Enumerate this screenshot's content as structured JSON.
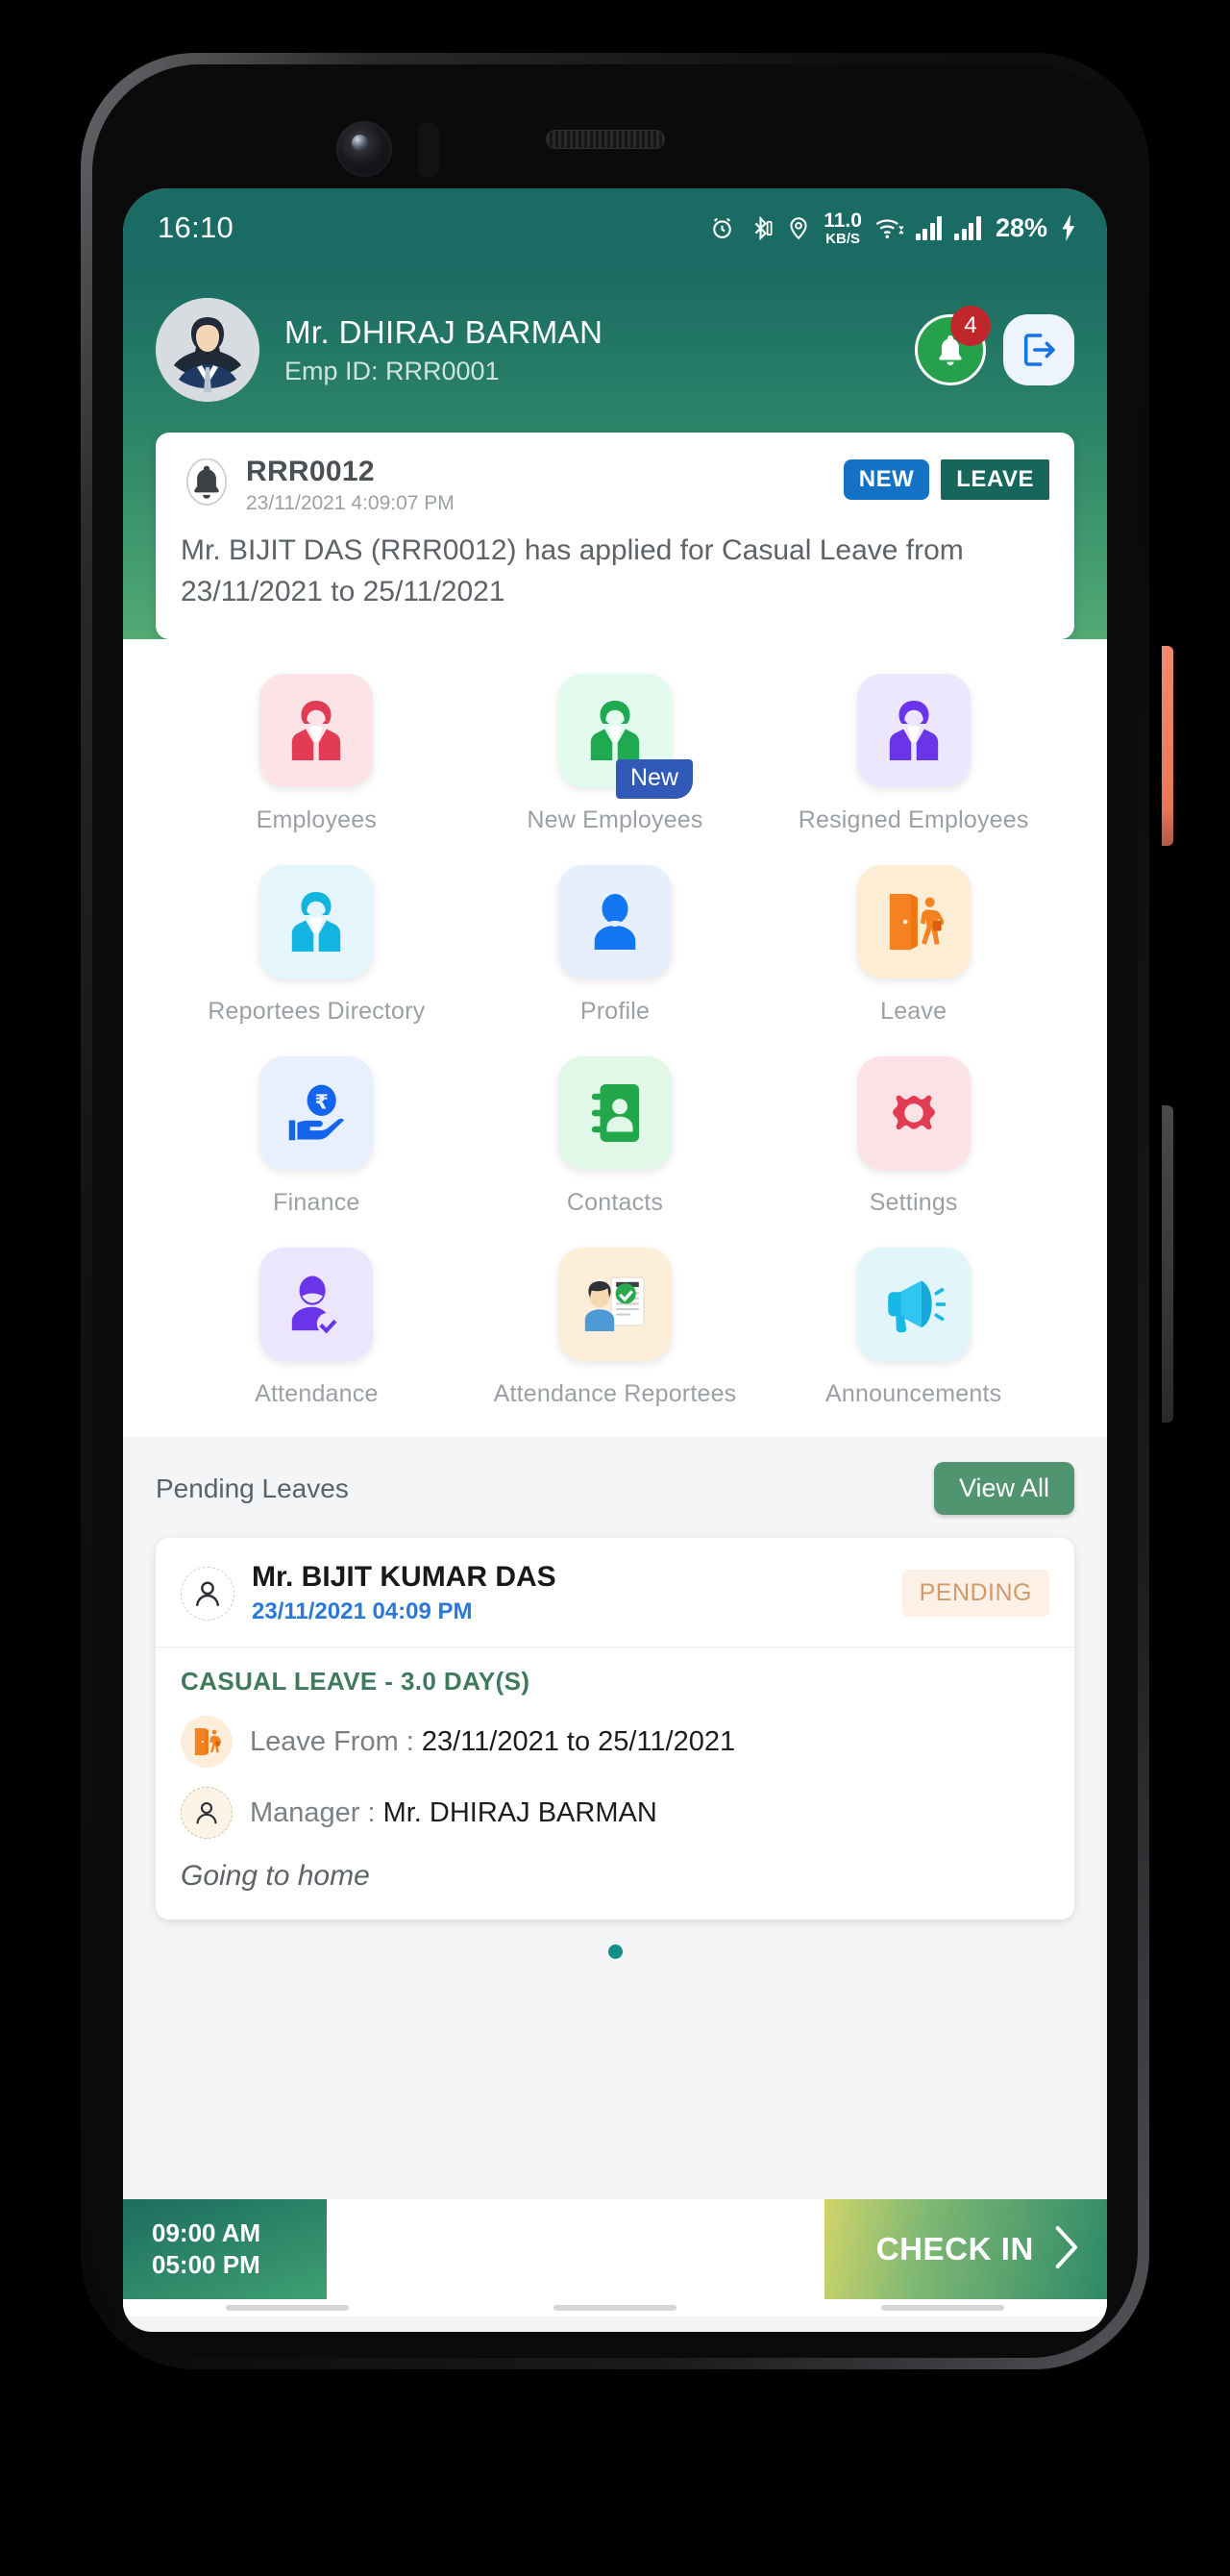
{
  "status_bar": {
    "time": "16:10",
    "icons": [
      "alarm-icon",
      "bluetooth-icon",
      "location-icon",
      "wifi-icon",
      "signal-icon",
      "signal-icon"
    ],
    "net_speed_value": "11.0",
    "net_speed_unit": "KB/S",
    "battery_percent": "28%"
  },
  "header": {
    "user_name": "Mr. DHIRAJ  BARMAN",
    "emp_id": "Emp ID: RRR0001",
    "notification_count": "4",
    "notification_icon": "bell-icon",
    "logout_icon": "logout-icon",
    "avatar_icon": "user-avatar"
  },
  "notification_card": {
    "bell_icon": "bell-icon",
    "emp_id": "RRR0012",
    "datetime": "23/11/2021 4:09:07 PM",
    "tag_new": "NEW",
    "tag_leave": "LEAVE",
    "message": "Mr. BIJIT DAS (RRR0012) has applied for Casual Leave from 23/11/2021 to 25/11/2021"
  },
  "menu": {
    "items": [
      {
        "label": "Employees",
        "icon": "employee-icon",
        "tile_color": "#fbe3e7",
        "icon_color": "#e13c53",
        "badge": ""
      },
      {
        "label": "New Employees",
        "icon": "new-employee-icon",
        "tile_color": "#e3fbef",
        "icon_color": "#1faa52",
        "badge": "New"
      },
      {
        "label": "Resigned Employees",
        "icon": "resigned-employee-icon",
        "tile_color": "#ece7fd",
        "icon_color": "#6a35e8",
        "badge": ""
      },
      {
        "label": "Reportees Directory",
        "icon": "reportees-directory-icon",
        "tile_color": "#e4f5fb",
        "icon_color": "#12b4e0",
        "badge": ""
      },
      {
        "label": "Profile",
        "icon": "profile-icon",
        "tile_color": "#e7effd",
        "icon_color": "#1376f3",
        "badge": ""
      },
      {
        "label": "Leave",
        "icon": "leave-door-icon",
        "tile_color": "#fdedd4",
        "icon_color": "#f58220",
        "badge": ""
      },
      {
        "label": "Finance",
        "icon": "finance-rupee-icon",
        "tile_color": "#e8effd",
        "icon_color": "#1565ec",
        "badge": ""
      },
      {
        "label": "Contacts",
        "icon": "contacts-book-icon",
        "tile_color": "#e1f8e8",
        "icon_color": "#22a74a",
        "badge": ""
      },
      {
        "label": "Settings",
        "icon": "settings-gear-icon",
        "tile_color": "#fbe2e7",
        "icon_color": "#e13c53",
        "badge": ""
      },
      {
        "label": "Attendance",
        "icon": "attendance-check-icon",
        "tile_color": "#ece6fd",
        "icon_color": "#6a35e8",
        "badge": ""
      },
      {
        "label": "Attendance Reportees",
        "icon": "attendance-reportees-icon",
        "tile_color": "#fdeed9",
        "icon_color": "#f3a54a",
        "badge": ""
      },
      {
        "label": "Announcements",
        "icon": "megaphone-icon",
        "tile_color": "#e1f5fb",
        "icon_color": "#16b8e6",
        "badge": ""
      }
    ]
  },
  "pending_leaves": {
    "title": "Pending Leaves",
    "view_all_label": "View All",
    "card": {
      "person_icon": "person-circle-icon",
      "person_name": "Mr. BIJIT KUMAR DAS",
      "applied_date": "23/11/2021 04:09 PM",
      "status": "PENDING",
      "leave_type": "CASUAL LEAVE - 3.0 DAY(S)",
      "leave_from_icon": "leave-door-icon",
      "leave_from_label": "Leave From :",
      "leave_from_value": "23/11/2021 to 25/11/2021",
      "manager_icon": "person-circle-icon",
      "manager_label": "Manager :",
      "manager_value": "Mr. DHIRAJ  BARMAN",
      "reason": "Going to home"
    }
  },
  "bottom_bar": {
    "shift_start": "09:00 AM",
    "shift_end": "05:00 PM",
    "check_in_label": "CHECK IN",
    "chevron_icon": "chevron-right-icon"
  },
  "colors": {
    "brand_teal": "#1a6b63",
    "brand_green": "#52ab74",
    "accent_blue": "#1472c4",
    "pending_orange": "#d09a6c",
    "badge_red": "#c0272d"
  }
}
